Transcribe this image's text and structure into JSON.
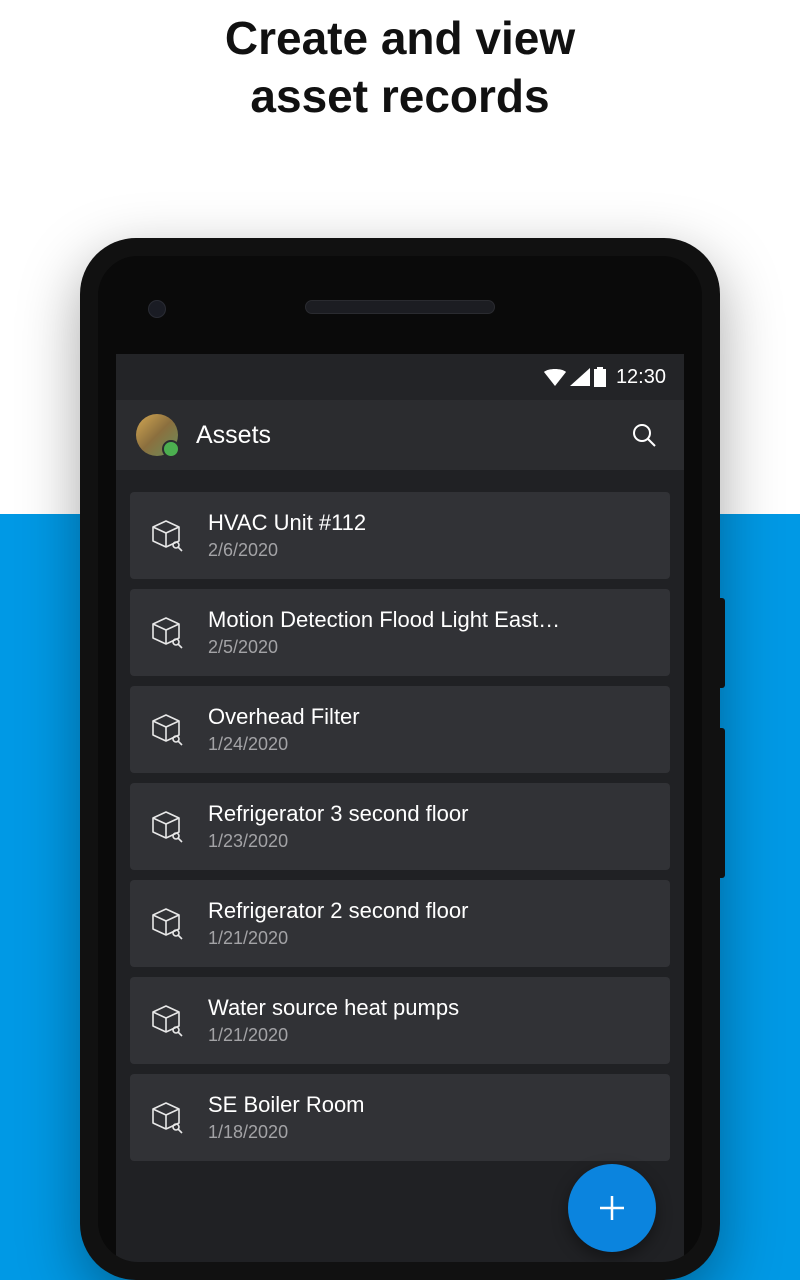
{
  "headline_line1": "Create and view",
  "headline_line2": "asset records",
  "statusbar": {
    "time": "12:30"
  },
  "header": {
    "title": "Assets"
  },
  "assets": [
    {
      "title": "HVAC Unit #112",
      "date": "2/6/2020"
    },
    {
      "title": "Motion Detection Flood Light East…",
      "date": "2/5/2020"
    },
    {
      "title": "Overhead Filter",
      "date": "1/24/2020"
    },
    {
      "title": "Refrigerator 3 second floor",
      "date": "1/23/2020"
    },
    {
      "title": "Refrigerator 2 second floor",
      "date": "1/21/2020"
    },
    {
      "title": "Water source heat pumps",
      "date": "1/21/2020"
    },
    {
      "title": "SE Boiler Room",
      "date": "1/18/2020"
    }
  ]
}
